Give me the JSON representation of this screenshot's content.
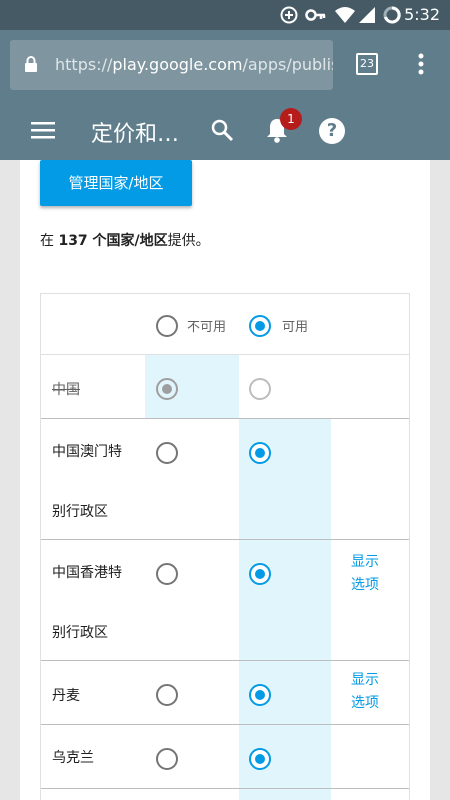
{
  "status_bar": {
    "time": "5:32",
    "icons": [
      "data-saver-icon",
      "key-icon",
      "wifi-icon",
      "signal-icon",
      "battery-icon"
    ]
  },
  "browser": {
    "url_host": "play.google.com",
    "url_prefix": "https://",
    "url_path": "/apps/publish/",
    "tab_count": "23"
  },
  "app_bar": {
    "title": "定价和…",
    "notification_count": "1",
    "help_label": "?"
  },
  "main": {
    "manage_button": "管理国家/地区",
    "summary_prefix": "在 ",
    "summary_bold": "137 个国家/地区",
    "summary_suffix": "提供。"
  },
  "table": {
    "header": {
      "unavailable": "不可用",
      "available": "可用"
    },
    "rows": [
      {
        "name": "中国",
        "available": false,
        "disabled": true
      },
      {
        "name_line1": "中国澳门特",
        "name_line2": "别行政区",
        "available": true
      },
      {
        "name_line1": "中国香港特",
        "name_line2": "别行政区",
        "available": true,
        "show_options_1": "显示",
        "show_options_2": "选项"
      },
      {
        "name": "丹麦",
        "available": true,
        "show_options_1": "显示",
        "show_options_2": "选项"
      },
      {
        "name": "乌克兰",
        "available": true
      }
    ]
  },
  "colors": {
    "app_bar": "#607d8b",
    "status_bar": "#455a64",
    "accent": "#039be5",
    "highlight": "#e1f5fd",
    "badge": "#b71c1c"
  }
}
